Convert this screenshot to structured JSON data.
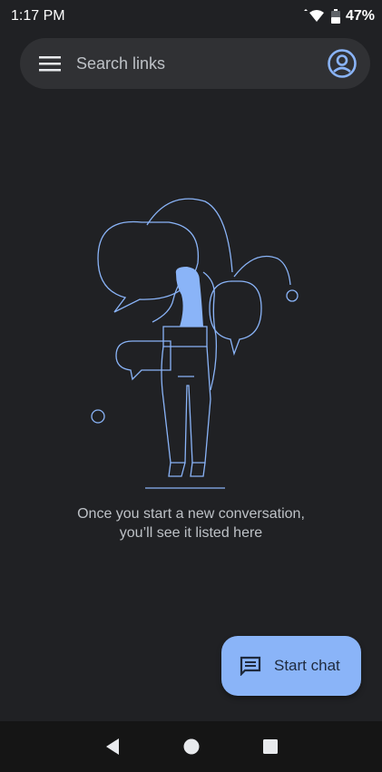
{
  "status_bar": {
    "time": "1:17 PM",
    "battery": "47%"
  },
  "search": {
    "placeholder": "Search links",
    "menu_icon": "hamburger-menu-icon",
    "account_icon": "account-circle-icon"
  },
  "empty_state": {
    "line1": "Once you start a new conversation,",
    "line2": "you’ll see it listed here",
    "illustration": "person-with-speech-bubbles-illustration"
  },
  "fab": {
    "label": "Start chat",
    "icon": "message-icon"
  },
  "nav": {
    "back_icon": "back-triangle-icon",
    "home_icon": "home-circle-icon",
    "recents_icon": "recents-square-icon"
  },
  "colors": {
    "background": "#202124",
    "surface": "#303134",
    "accent": "#8ab4f8",
    "text_secondary": "#bdc1c6"
  }
}
